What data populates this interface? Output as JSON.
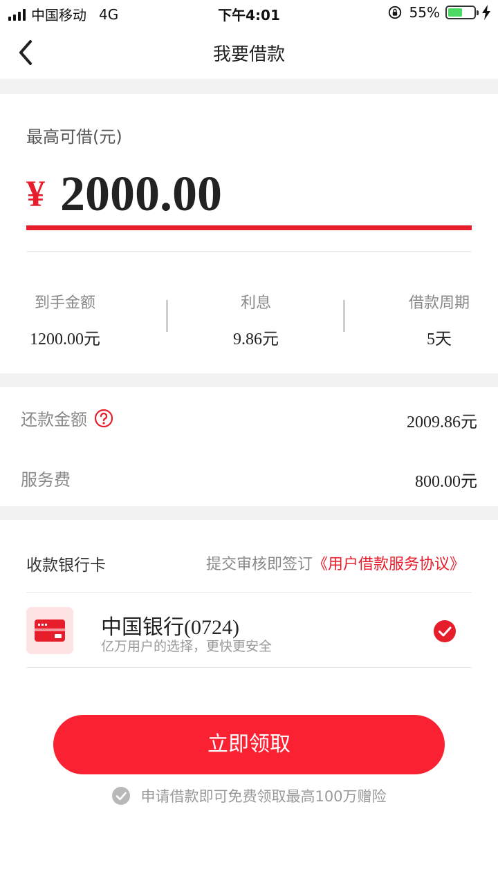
{
  "status_bar": {
    "carrier": "中国移动",
    "network": "4G",
    "time": "下午4:01",
    "battery": "55%",
    "battery_level": 0.55,
    "battery_color": "#4cd964"
  },
  "nav": {
    "back_icon": "chevron-left-icon",
    "title": "我要借款"
  },
  "amount": {
    "label": "最高可借(元)",
    "currency": "¥",
    "value": "2000.00"
  },
  "stats": [
    {
      "label": "到手金额",
      "value": "1200.00元"
    },
    {
      "label": "利息",
      "value": "9.86元"
    },
    {
      "label": "借款周期",
      "value": "5天"
    }
  ],
  "repayment": {
    "label": "还款金额",
    "value": "2009.86元",
    "help_icon": "question-circle-icon"
  },
  "service_fee": {
    "label": "服务费",
    "value": "800.00元"
  },
  "bank": {
    "section_title": "收款银行卡",
    "agreement_prefix": "提交审核即签订",
    "agreement_link": "《用户借款服务协议》",
    "card_icon": "credit-card-icon",
    "card_name": "中国银行",
    "card_number": "(0724)",
    "card_subtitle": "亿万用户的选择，更快更安全",
    "check_icon": "check-circle-icon"
  },
  "cta": {
    "label": "立即领取"
  },
  "notice": {
    "text": "申请借款即可免费领取最高100万赠险"
  },
  "colors": {
    "accent": "#e61e2b",
    "button": "#fa2132",
    "band": "#f2f2f2"
  }
}
